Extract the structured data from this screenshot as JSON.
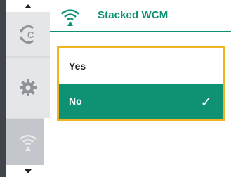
{
  "header": {
    "title": "Stacked WCM",
    "icon": "wireless-signal-icon"
  },
  "rail": {
    "items": [
      {
        "icon": "mode-cycle-icon"
      },
      {
        "icon": "gear-icon"
      },
      {
        "icon": "wireless-signal-icon",
        "selected": true
      }
    ]
  },
  "dialog": {
    "options": [
      {
        "label": "Yes",
        "selected": false
      },
      {
        "label": "No",
        "selected": true,
        "mark": "✓"
      }
    ]
  },
  "colors": {
    "accent": "#0f9174",
    "focus_border": "#f0b321",
    "rail_bg": "#d9dcdf",
    "rail_edge": "#3f454b"
  }
}
